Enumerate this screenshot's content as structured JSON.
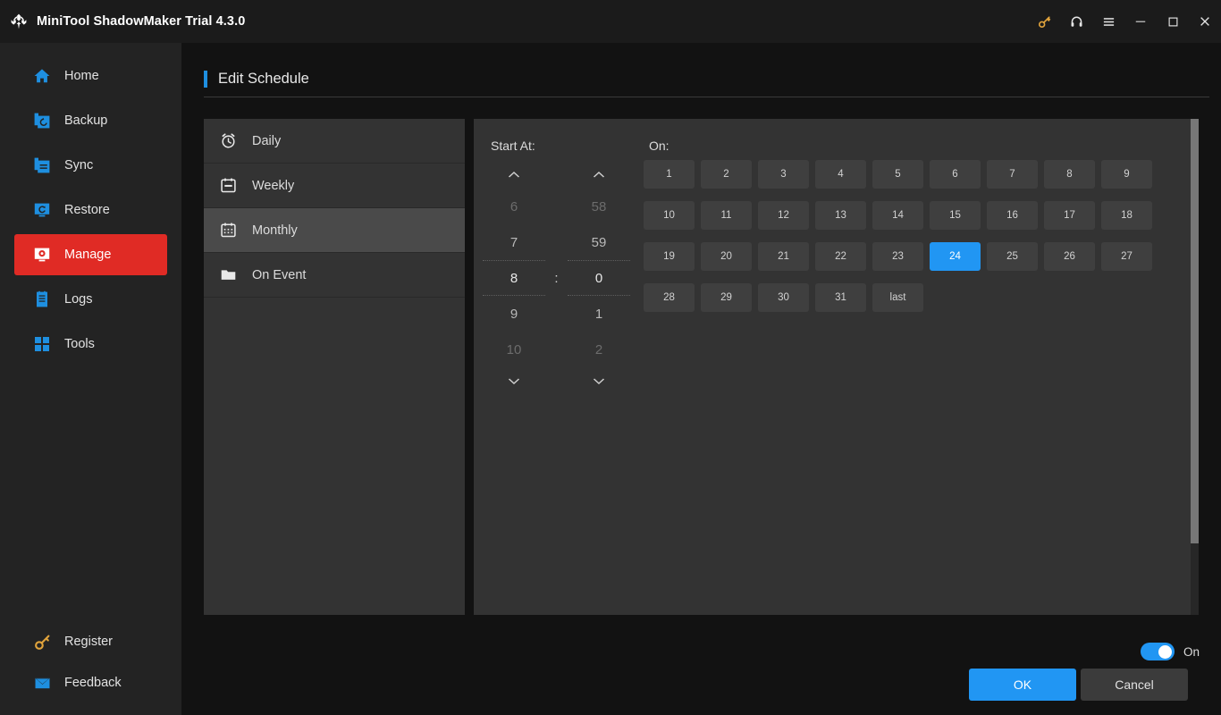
{
  "titlebar": {
    "app_title": "MiniTool ShadowMaker Trial 4.3.0",
    "logo_icon": "shadowmaker-logo-icon",
    "buttons": [
      {
        "name": "key-icon",
        "label": "",
        "color": "#e0a33c"
      },
      {
        "name": "headset-icon",
        "label": "",
        "color": "#e6e6e6"
      },
      {
        "name": "hamburger-menu-icon",
        "label": "",
        "color": "#e6e6e6"
      },
      {
        "name": "minimize-icon",
        "label": "",
        "color": "#e6e6e6"
      },
      {
        "name": "maximize-icon",
        "label": "",
        "color": "#e6e6e6"
      },
      {
        "name": "close-icon",
        "label": "",
        "color": "#e6e6e6"
      }
    ]
  },
  "sidebar": {
    "items": [
      {
        "label": "Home",
        "icon": "home-icon",
        "active": false
      },
      {
        "label": "Backup",
        "icon": "backup-icon",
        "active": false
      },
      {
        "label": "Sync",
        "icon": "sync-icon",
        "active": false
      },
      {
        "label": "Restore",
        "icon": "restore-icon",
        "active": false
      },
      {
        "label": "Manage",
        "icon": "manage-icon",
        "active": true
      },
      {
        "label": "Logs",
        "icon": "logs-icon",
        "active": false
      },
      {
        "label": "Tools",
        "icon": "tools-icon",
        "active": false
      }
    ],
    "bottom_items": [
      {
        "label": "Register",
        "icon": "key-icon"
      },
      {
        "label": "Feedback",
        "icon": "mail-icon"
      }
    ],
    "active_color": "#e02b25",
    "icon_color": "#1e8fe0"
  },
  "page": {
    "title": "Edit Schedule",
    "accent_color": "#1e8fe0"
  },
  "schedule_types": [
    {
      "label": "Daily",
      "icon": "alarm-clock-icon",
      "selected": false
    },
    {
      "label": "Weekly",
      "icon": "calendar-week-icon",
      "selected": false
    },
    {
      "label": "Monthly",
      "icon": "calendar-month-icon",
      "selected": true
    },
    {
      "label": "On Event",
      "icon": "folder-icon",
      "selected": false
    }
  ],
  "detail": {
    "start_at_label": "Start At:",
    "on_label": "On:",
    "time_separator": ":",
    "up_arrow_icon": "chevron-up-icon",
    "down_arrow_icon": "chevron-down-icon",
    "hours": [
      {
        "value": "6",
        "state": "far"
      },
      {
        "value": "7",
        "state": "near"
      },
      {
        "value": "8",
        "state": "current"
      },
      {
        "value": "9",
        "state": "near"
      },
      {
        "value": "10",
        "state": "far"
      }
    ],
    "minutes": [
      {
        "value": "58",
        "state": "far"
      },
      {
        "value": "59",
        "state": "near"
      },
      {
        "value": "0",
        "state": "current"
      },
      {
        "value": "1",
        "state": "near"
      },
      {
        "value": "2",
        "state": "far"
      }
    ],
    "selected_hour": "8",
    "selected_minute": "0",
    "day_rows": [
      [
        {
          "label": "1",
          "selected": false
        },
        {
          "label": "2",
          "selected": false
        },
        {
          "label": "3",
          "selected": false
        },
        {
          "label": "4",
          "selected": false
        },
        {
          "label": "5",
          "selected": false
        },
        {
          "label": "6",
          "selected": false
        },
        {
          "label": "7",
          "selected": false
        },
        {
          "label": "8",
          "selected": false
        },
        {
          "label": "9",
          "selected": false
        }
      ],
      [
        {
          "label": "10",
          "selected": false
        },
        {
          "label": "11",
          "selected": false
        },
        {
          "label": "12",
          "selected": false
        },
        {
          "label": "13",
          "selected": false
        },
        {
          "label": "14",
          "selected": false
        },
        {
          "label": "15",
          "selected": false
        },
        {
          "label": "16",
          "selected": false
        },
        {
          "label": "17",
          "selected": false
        },
        {
          "label": "18",
          "selected": false
        }
      ],
      [
        {
          "label": "19",
          "selected": false
        },
        {
          "label": "20",
          "selected": false
        },
        {
          "label": "21",
          "selected": false
        },
        {
          "label": "22",
          "selected": false
        },
        {
          "label": "23",
          "selected": false
        },
        {
          "label": "24",
          "selected": true
        },
        {
          "label": "25",
          "selected": false
        },
        {
          "label": "26",
          "selected": false
        },
        {
          "label": "27",
          "selected": false
        }
      ],
      [
        {
          "label": "28",
          "selected": false
        },
        {
          "label": "29",
          "selected": false
        },
        {
          "label": "30",
          "selected": false
        },
        {
          "label": "31",
          "selected": false
        },
        {
          "label": "last",
          "selected": false
        }
      ]
    ],
    "selected_days": [
      "24"
    ],
    "selected_day_color": "#2196f3"
  },
  "footer": {
    "toggle_label": "On",
    "toggle_on": true,
    "ok_label": "OK",
    "cancel_label": "Cancel",
    "primary_color": "#2196f3"
  }
}
